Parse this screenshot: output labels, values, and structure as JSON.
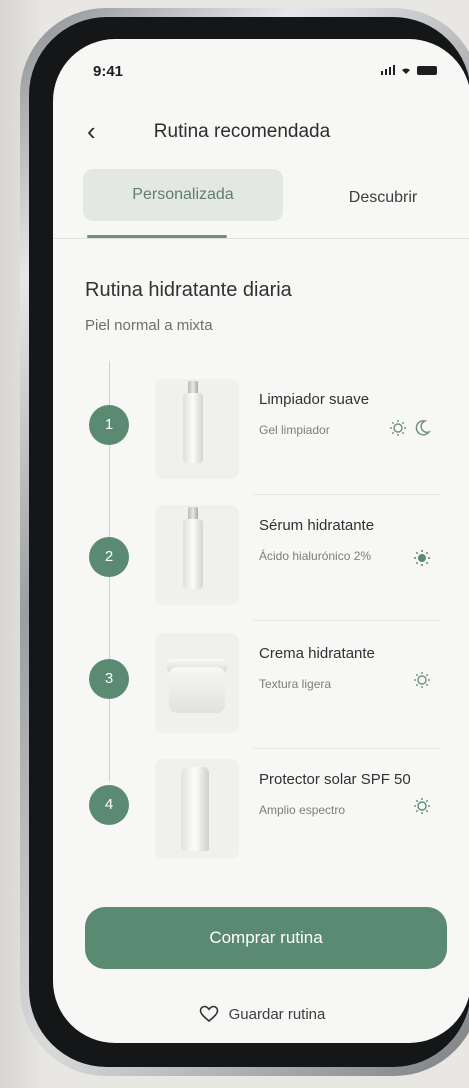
{
  "status_bar": {
    "time": "9:41"
  },
  "header": {
    "back_label": "‹",
    "title": "Rutina recomendada"
  },
  "tabs": [
    {
      "label": "Personalizada",
      "active": true
    },
    {
      "label": "Descubrir",
      "active": false
    }
  ],
  "routine": {
    "title": "Rutina hidratante diaria",
    "subtitle": "Piel normal a mixta"
  },
  "steps": [
    {
      "number": "1",
      "name": "Limpiador suave",
      "desc": "Gel limpiador",
      "icons": [
        "sun-icon",
        "moon-icon"
      ]
    },
    {
      "number": "2",
      "name": "Sérum hidratante",
      "desc": "Ácido hialurónico 2%",
      "icons": [
        "sun-icon"
      ]
    },
    {
      "number": "3",
      "name": "Crema hidratante",
      "desc": "Textura ligera",
      "icons": [
        "sun-icon"
      ]
    },
    {
      "number": "4",
      "name": "Protector solar SPF 50",
      "desc": "Amplio espectro",
      "icons": [
        "sun-icon"
      ]
    }
  ],
  "actions": {
    "buy_label": "Comprar rutina",
    "save_label": "Guardar rutina"
  },
  "colors": {
    "accent": "#5b8a73",
    "tab_active_bg": "#e4e8e5",
    "screen_bg": "#f7f7f5"
  }
}
